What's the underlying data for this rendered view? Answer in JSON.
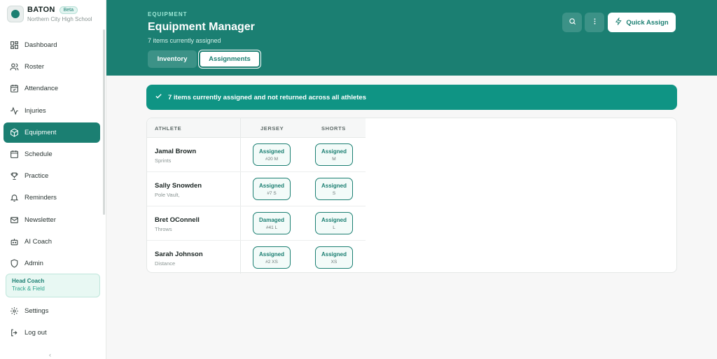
{
  "brand": {
    "name": "BATON",
    "badge": "Beta",
    "school": "Northern City High School"
  },
  "nav": [
    {
      "label": "Dashboard",
      "icon": "dashboard-icon",
      "active": false
    },
    {
      "label": "Roster",
      "icon": "users-icon",
      "active": false
    },
    {
      "label": "Attendance",
      "icon": "calendar-check-icon",
      "active": false
    },
    {
      "label": "Injuries",
      "icon": "activity-icon",
      "active": false
    },
    {
      "label": "Equipment",
      "icon": "box-icon",
      "active": true
    },
    {
      "label": "Schedule",
      "icon": "calendar-icon",
      "active": false
    },
    {
      "label": "Practice",
      "icon": "trophy-icon",
      "active": false
    },
    {
      "label": "Reminders",
      "icon": "bell-icon",
      "active": false
    },
    {
      "label": "Newsletter",
      "icon": "mail-icon",
      "active": false
    },
    {
      "label": "AI Coach",
      "icon": "bot-icon",
      "active": false
    },
    {
      "label": "Admin",
      "icon": "shield-icon",
      "active": false
    }
  ],
  "role": {
    "title": "Head Coach",
    "sport": "Track & Field"
  },
  "bottom_nav": [
    {
      "label": "Settings",
      "icon": "gear-icon"
    },
    {
      "label": "Log out",
      "icon": "logout-icon"
    }
  ],
  "header": {
    "eyebrow": "EQUIPMENT",
    "title": "Equipment Manager",
    "subtitle": "7 items currently assigned",
    "tabs": [
      {
        "label": "Inventory"
      },
      {
        "label": "Assignments"
      }
    ],
    "quick_assign_label": "Quick Assign"
  },
  "banner": {
    "text": "7 items currently assigned and not returned across all athletes"
  },
  "table": {
    "columns": [
      "ATHLETE",
      "JERSEY",
      "SHORTS"
    ],
    "rows": [
      {
        "name": "Jamal Brown",
        "event": "Sprints",
        "jersey": {
          "status": "Assigned",
          "detail": "#20 M"
        },
        "shorts": {
          "status": "Assigned",
          "detail": "M"
        }
      },
      {
        "name": "Sally Snowden",
        "event": "Pole Vault,",
        "jersey": {
          "status": "Assigned",
          "detail": "#7 S"
        },
        "shorts": {
          "status": "Assigned",
          "detail": "S"
        }
      },
      {
        "name": "Bret OConnell",
        "event": "Throws",
        "jersey": {
          "status": "Damaged",
          "detail": "#41 L"
        },
        "shorts": {
          "status": "Assigned",
          "detail": "L"
        }
      },
      {
        "name": "Sarah Johnson",
        "event": "Distance",
        "jersey": {
          "status": "Assigned",
          "detail": "#2 XS"
        },
        "shorts": {
          "status": "Assigned",
          "detail": "XS"
        }
      }
    ]
  },
  "colors": {
    "primary": "#1b7f72",
    "banner": "#0f9484",
    "accent_light": "#e8f8f3"
  }
}
